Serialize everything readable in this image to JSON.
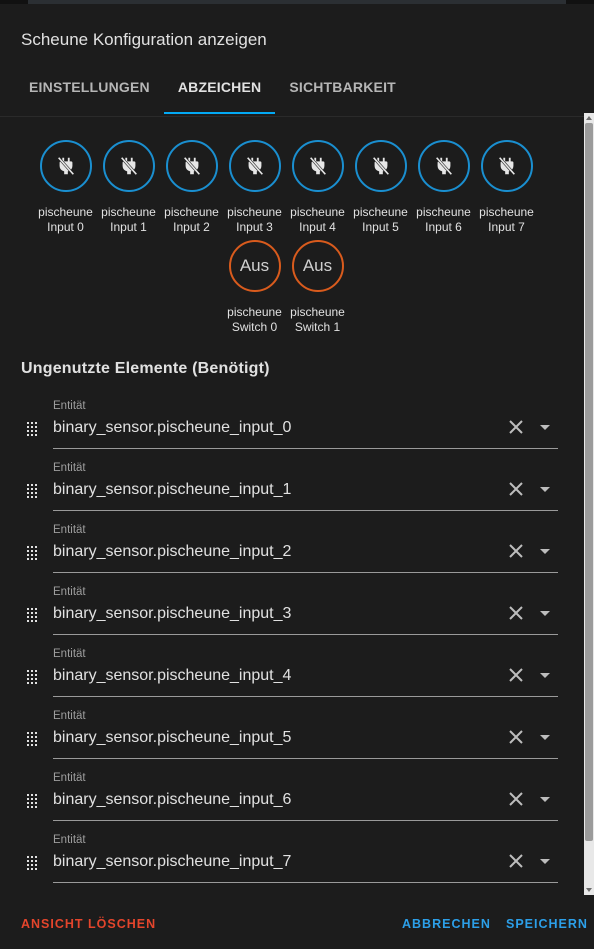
{
  "dialog": {
    "title": "Scheune Konfiguration anzeigen"
  },
  "tabs": [
    {
      "label": "EINSTELLUNGEN"
    },
    {
      "label": "ABZEICHEN"
    },
    {
      "label": "SICHTBARKEIT"
    }
  ],
  "active_tab": "ABZEICHEN",
  "badges": [
    {
      "icon": "power-plug-off-icon",
      "line1": "pischeune",
      "line2": "Input 0"
    },
    {
      "icon": "power-plug-off-icon",
      "line1": "pischeune",
      "line2": "Input 1"
    },
    {
      "icon": "power-plug-off-icon",
      "line1": "pischeune",
      "line2": "Input 2"
    },
    {
      "icon": "power-plug-off-icon",
      "line1": "pischeune",
      "line2": "Input 3"
    },
    {
      "icon": "power-plug-off-icon",
      "line1": "pischeune",
      "line2": "Input 4"
    },
    {
      "icon": "power-plug-off-icon",
      "line1": "pischeune",
      "line2": "Input 5"
    },
    {
      "icon": "power-plug-off-icon",
      "line1": "pischeune",
      "line2": "Input 6"
    },
    {
      "icon": "power-plug-off-icon",
      "line1": "pischeune",
      "line2": "Input 7"
    },
    {
      "state": "Aus",
      "line1": "pischeune",
      "line2": "Switch 0"
    },
    {
      "state": "Aus",
      "line1": "pischeune",
      "line2": "Switch 1"
    }
  ],
  "section": {
    "title": "Ungenutzte Elemente (Benötigt)"
  },
  "entities": [
    {
      "label": "Entität",
      "value": "binary_sensor.pischeune_input_0"
    },
    {
      "label": "Entität",
      "value": "binary_sensor.pischeune_input_1"
    },
    {
      "label": "Entität",
      "value": "binary_sensor.pischeune_input_2"
    },
    {
      "label": "Entität",
      "value": "binary_sensor.pischeune_input_3"
    },
    {
      "label": "Entität",
      "value": "binary_sensor.pischeune_input_4"
    },
    {
      "label": "Entität",
      "value": "binary_sensor.pischeune_input_5"
    },
    {
      "label": "Entität",
      "value": "binary_sensor.pischeune_input_6"
    },
    {
      "label": "Entität",
      "value": "binary_sensor.pischeune_input_7"
    }
  ],
  "footer": {
    "delete_label": "ANSICHT LÖSCHEN",
    "cancel_label": "ABBRECHEN",
    "save_label": "SPEICHERN"
  },
  "colors": {
    "accent": "#03a9f4",
    "badge_on_border": "#1a8fd0",
    "badge_off_border": "#d95b1d",
    "danger": "#e4452c",
    "background": "#1c1c1c"
  }
}
